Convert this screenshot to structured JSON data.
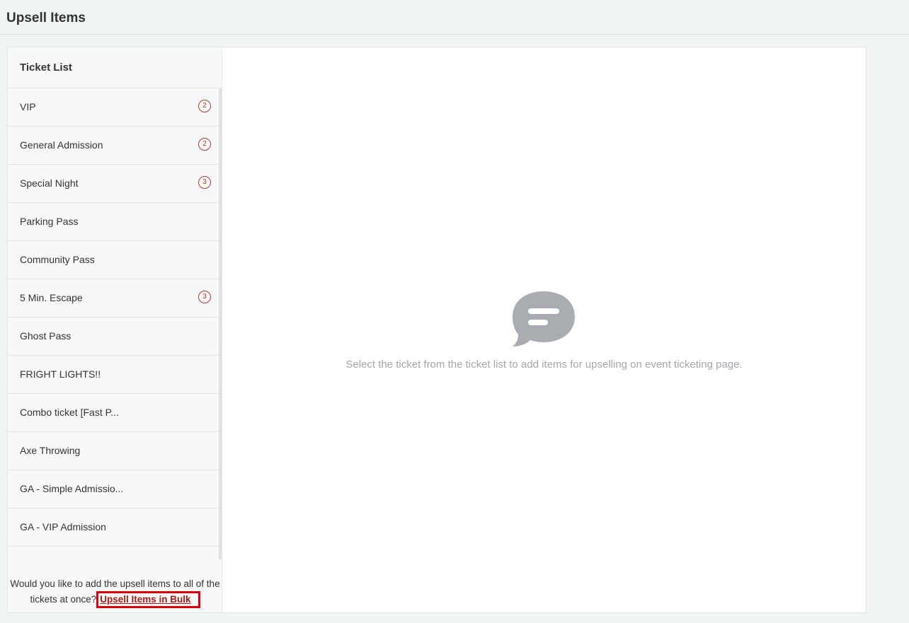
{
  "header": {
    "title": "Upsell Items"
  },
  "ticket_list": {
    "heading": "Ticket List",
    "items": [
      {
        "label": "VIP",
        "count": "2"
      },
      {
        "label": "General Admission",
        "count": "2"
      },
      {
        "label": "Special Night",
        "count": "3"
      },
      {
        "label": "Parking Pass",
        "count": null
      },
      {
        "label": "Community Pass",
        "count": null
      },
      {
        "label": "5 Min. Escape",
        "count": "3"
      },
      {
        "label": "Ghost Pass",
        "count": null
      },
      {
        "label": "FRIGHT LIGHTS!!",
        "count": null
      },
      {
        "label": "Combo ticket [Fast P...",
        "count": null
      },
      {
        "label": "Axe Throwing",
        "count": null
      },
      {
        "label": "GA - Simple Admissio...",
        "count": null
      },
      {
        "label": "GA - VIP Admission",
        "count": null
      }
    ],
    "bulk_prompt": "Would you like to add the upsell items to all of the tickets at once?",
    "bulk_link": "Upsell Items in Bulk"
  },
  "empty_state": {
    "icon": "chat-bubble-icon",
    "message": "Select the ticket from the ticket list to add items for upselling on event ticketing page."
  },
  "colors": {
    "badge": "#b23a2e",
    "link": "#a11d16",
    "highlight_border": "#e0000a",
    "icon": "#a9adb2"
  }
}
